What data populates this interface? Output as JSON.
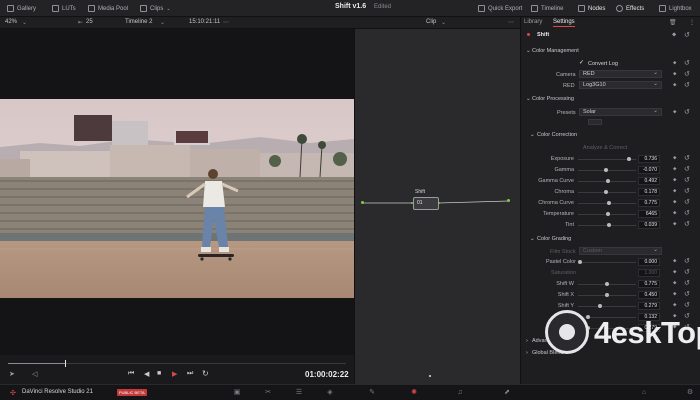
{
  "topbar": {
    "gallery": "Gallery",
    "luts": "LUTs",
    "media_pool": "Media Pool",
    "clips": "Clips",
    "project_title": "Shift v1.6",
    "project_status": "Edited",
    "quick_export": "Quick Export",
    "timeline": "Timeline",
    "nodes": "Nodes",
    "effects": "Effects",
    "lightbox": "Lightbox"
  },
  "subbar": {
    "zoom": "42%",
    "frame_count": "25",
    "timeline_name": "Timeline 2",
    "timecode": "15:10:21:11",
    "clip_mode": "Clip"
  },
  "nodes": {
    "node_label": "Shift",
    "node_number": "01"
  },
  "inspector": {
    "tabs": [
      "Library",
      "Settings"
    ],
    "effect_name": "Shift",
    "color_management": {
      "title": "Color Management",
      "convert_log": "Convert Log",
      "camera_label": "Camera",
      "camera_value": "RED",
      "red_label": "RED",
      "red_value": "Log3G10"
    },
    "color_processing": {
      "title": "Color Processing",
      "presets_label": "Presets",
      "presets_value": "Solar"
    },
    "color_correction": {
      "title": "Color Correction",
      "analyze": "Analyze & Correct",
      "params": [
        {
          "label": "Exposure",
          "value": "0.736",
          "pos": 0.88
        },
        {
          "label": "Gamma",
          "value": "-0.070",
          "pos": 0.46
        },
        {
          "label": "Gamma Curve",
          "value": "0.492",
          "pos": 0.5
        },
        {
          "label": "Chroma",
          "value": "0.178",
          "pos": 0.46
        },
        {
          "label": "Chroma Curve",
          "value": "0.775",
          "pos": 0.52
        },
        {
          "label": "Temperature",
          "value": "6465",
          "pos": 0.5
        },
        {
          "label": "Tint",
          "value": "0.039",
          "pos": 0.52
        }
      ]
    },
    "color_grading": {
      "title": "Color Grading",
      "film_stock_label": "Film Stock",
      "film_stock_value": "Custom",
      "pastel_color_label": "Pastel Color",
      "pastel_color_value": "0.000",
      "saturation_label": "Saturation",
      "saturation_value": "1.000",
      "params": [
        {
          "label": "Shift W",
          "value": "0.775",
          "pos": 0.48
        },
        {
          "label": "Shift X",
          "value": "0.450",
          "pos": 0.48
        },
        {
          "label": "Shift Y",
          "value": "0.279",
          "pos": 0.35
        },
        {
          "label": "Shift Z",
          "value": "0.132",
          "pos": 0.14
        },
        {
          "label": "Burn",
          "value": "0.279",
          "pos": 0.14
        }
      ]
    },
    "advanced_settings": "Advanced Settings",
    "global_blend": "Global Blend"
  },
  "transport": {
    "timecode": "01:00:02:22",
    "progress": 0.17
  },
  "pagebar": {
    "app_name": "DaVinci Resolve Studio 21",
    "badge": "PUBLIC BETA"
  },
  "watermark": {
    "text": "4eskTop"
  },
  "colors": {
    "accent_red": "#d84a4a",
    "node_green": "#7ad13b",
    "badge_red": "#c43a3a"
  }
}
